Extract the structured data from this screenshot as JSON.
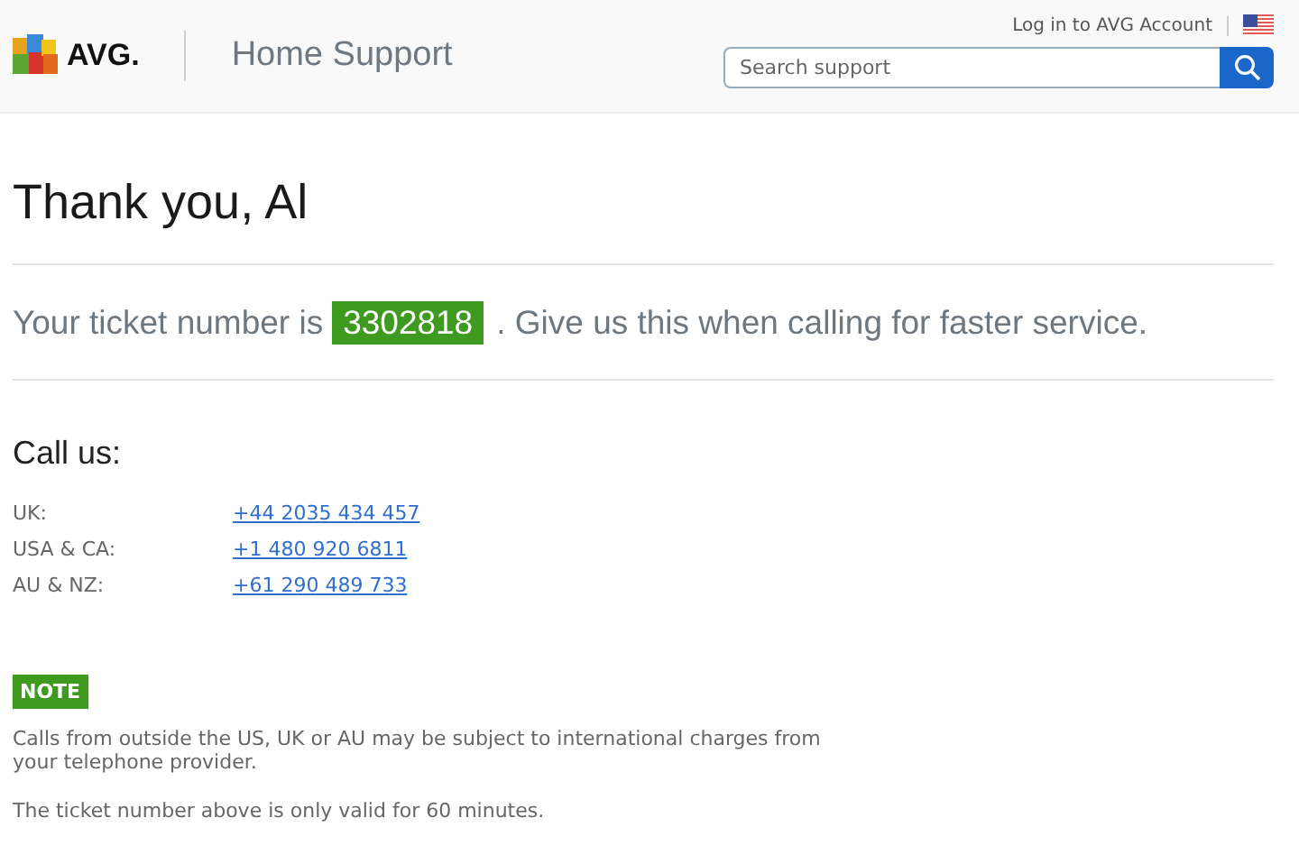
{
  "header": {
    "brand": "AVG.",
    "section": "Home Support",
    "account_link": "Log in to AVG Account",
    "search": {
      "placeholder": "Search support"
    }
  },
  "title": "Thank you, Al",
  "ticket": {
    "prefix": "Your ticket number is",
    "number": "3302818",
    "suffix": ". Give us this when calling for faster service."
  },
  "call": {
    "heading": "Call us:",
    "lines": [
      {
        "region": "UK:",
        "phone": "+44 2035 434 457"
      },
      {
        "region": "USA & CA:",
        "phone": "+1 480 920 6811"
      },
      {
        "region": "AU & NZ:",
        "phone": "+61 290 489 733"
      }
    ]
  },
  "note": {
    "badge": "NOTE",
    "paragraphs": [
      "Calls from outside the US, UK or AU may be subject to international charges from your telephone provider.",
      "The ticket number above is only valid for 60 minutes."
    ]
  }
}
